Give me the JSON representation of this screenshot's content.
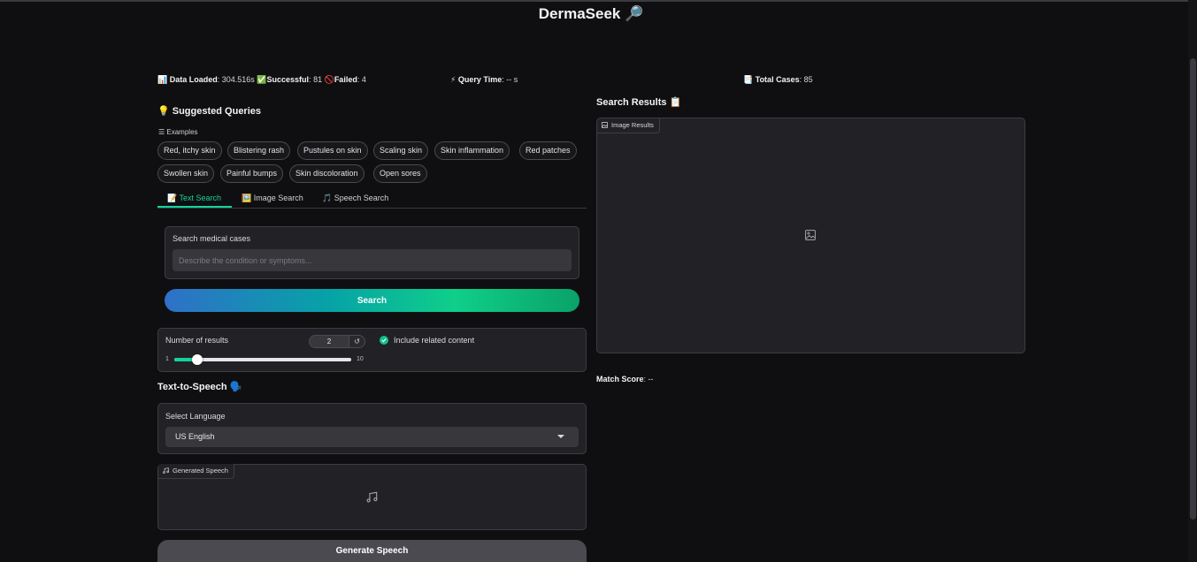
{
  "app": {
    "title": "DermaSeek 🔎"
  },
  "stats": {
    "data_loaded": {
      "icon": "📊",
      "label": "Data Loaded",
      "value": ": 304.516s"
    },
    "successful": {
      "icon": "✅",
      "label": "Successful",
      "value": ": 81"
    },
    "failed": {
      "icon": "🚫",
      "label": "Failed",
      "value": ": 4"
    },
    "query_time": {
      "icon": "⚡",
      "label": "Query Time",
      "value": ": -- s"
    },
    "total_cases": {
      "icon": "📑",
      "label": "Total Cases",
      "value": ": 85"
    }
  },
  "suggested": {
    "title": "💡 Suggested Queries",
    "examples_label": "☰ Examples",
    "chips": [
      "Red, itchy skin",
      "Blistering rash",
      "Pustules on skin",
      "Scaling skin",
      "Skin inflammation",
      "Red patches",
      "Swollen skin",
      "Painful bumps",
      "Skin discoloration",
      "Open sores"
    ]
  },
  "tabs": [
    {
      "label": "📝 Text Search",
      "active": true
    },
    {
      "label": "🖼️ Image Search",
      "active": false
    },
    {
      "label": "🎵 Speech Search",
      "active": false
    }
  ],
  "text_search": {
    "label": "Search medical cases",
    "placeholder": "Describe the condition or symptoms...",
    "value": "",
    "button": "Search"
  },
  "options": {
    "num_results_label": "Number of results",
    "num_results_value": "2",
    "reset_glyph": "↺",
    "slider_min": "1",
    "slider_max": "10",
    "slider_value": 2,
    "include_related_label": "Include related content",
    "include_related_checked": true
  },
  "tts": {
    "title": "Text-to-Speech 🗣️",
    "language_label": "Select Language",
    "language_value": "US English",
    "output_label": "Generated Speech",
    "button": "Generate Speech"
  },
  "results": {
    "title": "Search Results 📋",
    "image_label": "Image Results",
    "match_label": "Match Score",
    "match_value": ": --"
  },
  "colors": {
    "background": "#0f0f11",
    "panel": "#222226",
    "accent": "#12d39d",
    "search_gradient": [
      "#2f70c8",
      "#06a3a6",
      "#0fcf8a",
      "#0aa268"
    ],
    "secondary_button": "#4b4a50"
  },
  "icons": {
    "image_results": "image-icon",
    "generated_speech": "music-note-icon",
    "select_caret": "caret-down-icon",
    "checkbox": "check-icon"
  }
}
